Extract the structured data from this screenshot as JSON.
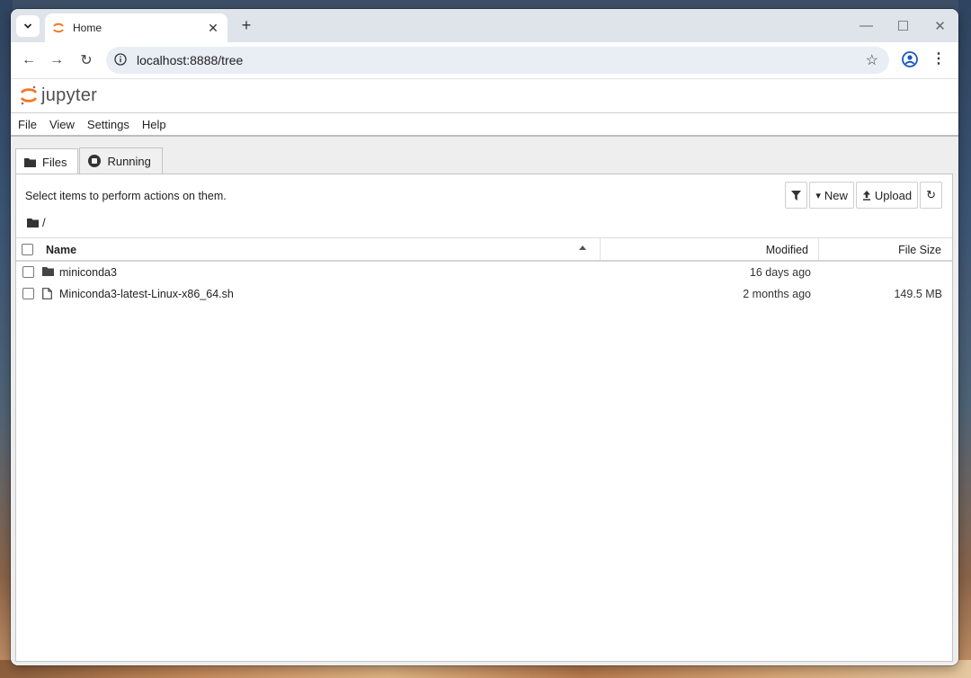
{
  "browser": {
    "tab_title": "Home",
    "url": "localhost:8888/tree",
    "icons": {
      "tab_dropdown": "chevron-down-icon",
      "tab_close": "close-icon",
      "new_tab": "plus-icon",
      "back": "arrow-left-icon",
      "forward": "arrow-right-icon",
      "reload": "reload-icon",
      "site_info": "info-icon",
      "bookmark": "star-icon",
      "profile": "profile-icon",
      "menu": "kebab-menu-icon"
    }
  },
  "jupyter": {
    "logo_text": "jupyter",
    "logo_color": "#f37726",
    "menu": [
      "File",
      "View",
      "Settings",
      "Help"
    ]
  },
  "tabs": [
    {
      "label": "Files",
      "icon": "folder-icon",
      "active": true
    },
    {
      "label": "Running",
      "icon": "stop-circle-icon",
      "active": false
    }
  ],
  "panel": {
    "hint": "Select items to perform actions on them.",
    "buttons": {
      "filter_icon": "filter-icon",
      "new_label": "New",
      "upload_label": "Upload",
      "refresh_icon": "refresh-icon"
    },
    "breadcrumb": "/"
  },
  "table": {
    "columns": {
      "name": "Name",
      "modified": "Modified",
      "size": "File Size"
    },
    "rows": [
      {
        "name": "miniconda3",
        "type": "folder",
        "modified": "16 days ago",
        "size": ""
      },
      {
        "name": "Miniconda3-latest-Linux-x86_64.sh",
        "type": "file",
        "modified": "2 months ago",
        "size": "149.5 MB"
      }
    ]
  }
}
